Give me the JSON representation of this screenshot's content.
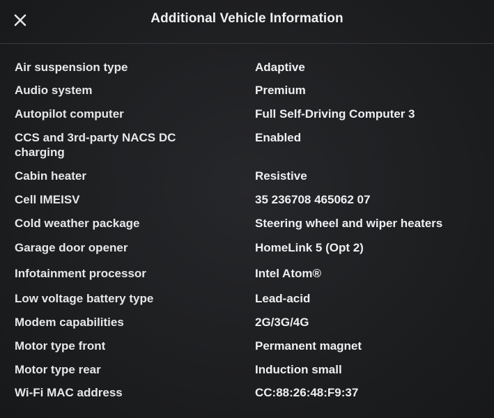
{
  "header": {
    "title": "Additional Vehicle Information",
    "close_icon": "close-icon"
  },
  "rows": [
    {
      "label": "Air suspension type",
      "value": "Adaptive"
    },
    {
      "label": "Audio system",
      "value": "Premium"
    },
    {
      "label": "Autopilot computer",
      "value": "Full Self-Driving Computer 3"
    },
    {
      "label": "CCS and 3rd-party NACS DC charging",
      "value": "Enabled"
    },
    {
      "label": "Cabin heater",
      "value": "Resistive"
    },
    {
      "label": "Cell IMEISV",
      "value": "35 236708 465062 07"
    },
    {
      "label": "Cold weather package",
      "value": "Steering wheel and wiper heaters"
    },
    {
      "label": "Garage door opener",
      "value": "HomeLink 5 (Opt 2)"
    },
    {
      "label": "Infotainment processor",
      "value": "Intel Atom®"
    },
    {
      "label": "Low voltage battery type",
      "value": "Lead-acid"
    },
    {
      "label": "Modem capabilities",
      "value": "2G/3G/4G"
    },
    {
      "label": "Motor type front",
      "value": "Permanent magnet"
    },
    {
      "label": "Motor type rear",
      "value": "Induction small"
    },
    {
      "label": "Wi-Fi MAC address",
      "value": "CC:88:26:48:F9:37"
    }
  ]
}
